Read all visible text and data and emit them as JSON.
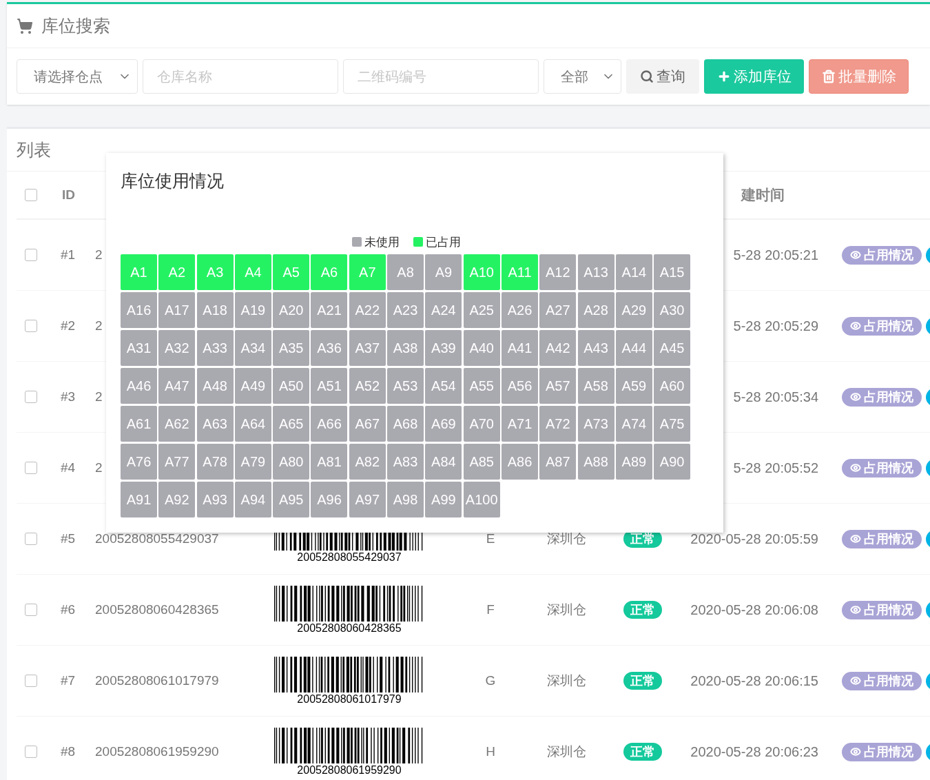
{
  "search_panel": {
    "title": "库位搜索",
    "warehouse_select": {
      "value": "请选择仓点"
    },
    "name_field": {
      "placeholder": "仓库名称"
    },
    "code_field": {
      "placeholder": "二维码编号"
    },
    "status_select": {
      "value": "全部"
    },
    "buttons": [
      {
        "kind": "search",
        "label": "查询"
      },
      {
        "kind": "add",
        "label": "添加库位"
      },
      {
        "kind": "delete",
        "label": "批量删除"
      }
    ]
  },
  "list_panel": {
    "title": "列表",
    "header": {
      "checked": false,
      "id": "ID",
      "created": "建时间"
    },
    "rows": [
      {
        "checked": false,
        "id": "#1",
        "code": "2",
        "created": "5-28 20:05:21",
        "action": "占用情况"
      },
      {
        "checked": false,
        "id": "#2",
        "code": "2",
        "created": "5-28 20:05:29",
        "action": "占用情况"
      },
      {
        "checked": false,
        "id": "#3",
        "code": "2",
        "created": "5-28 20:05:34",
        "action": "占用情况"
      },
      {
        "checked": false,
        "id": "#4",
        "code": "2",
        "created": "5-28 20:05:52",
        "action": "占用情况"
      },
      {
        "checked": false,
        "id": "#5",
        "code": "20052808055429037",
        "barcode": "20052808055429037",
        "location": "E",
        "warehouse": "深圳仓",
        "status": "正常",
        "created": "2020-05-28 20:05:59",
        "action": "占用情况"
      },
      {
        "checked": false,
        "id": "#6",
        "code": "20052808060428365",
        "barcode": "20052808060428365",
        "location": "F",
        "warehouse": "深圳仓",
        "status": "正常",
        "created": "2020-05-28 20:06:08",
        "action": "占用情况"
      },
      {
        "checked": false,
        "id": "#7",
        "code": "20052808061017979",
        "barcode": "20052808061017979",
        "location": "G",
        "warehouse": "深圳仓",
        "status": "正常",
        "created": "2020-05-28 20:06:15",
        "action": "占用情况"
      },
      {
        "checked": false,
        "id": "#8",
        "code": "20052808061959290",
        "barcode": "20052808061959290",
        "location": "H",
        "warehouse": "深圳仓",
        "status": "正常",
        "created": "2020-05-28 20:06:23",
        "action": "占用情况"
      }
    ]
  },
  "usage_popup": {
    "title": "库位使用情况",
    "legend": [
      {
        "label": "未使用",
        "color": "#a9a9b0"
      },
      {
        "label": "已占用",
        "color": "#25f263"
      }
    ],
    "slots": [
      {
        "label": "A1",
        "occupied": true
      },
      {
        "label": "A2",
        "occupied": true
      },
      {
        "label": "A3",
        "occupied": true
      },
      {
        "label": "A4",
        "occupied": true
      },
      {
        "label": "A5",
        "occupied": true
      },
      {
        "label": "A6",
        "occupied": true
      },
      {
        "label": "A7",
        "occupied": true
      },
      {
        "label": "A8",
        "occupied": false
      },
      {
        "label": "A9",
        "occupied": false
      },
      {
        "label": "A10",
        "occupied": true
      },
      {
        "label": "A11",
        "occupied": true
      },
      {
        "label": "A12",
        "occupied": false
      },
      {
        "label": "A13",
        "occupied": false
      },
      {
        "label": "A14",
        "occupied": false
      },
      {
        "label": "A15",
        "occupied": false
      },
      {
        "label": "A16",
        "occupied": false
      },
      {
        "label": "A17",
        "occupied": false
      },
      {
        "label": "A18",
        "occupied": false
      },
      {
        "label": "A19",
        "occupied": false
      },
      {
        "label": "A20",
        "occupied": false
      },
      {
        "label": "A21",
        "occupied": false
      },
      {
        "label": "A22",
        "occupied": false
      },
      {
        "label": "A23",
        "occupied": false
      },
      {
        "label": "A24",
        "occupied": false
      },
      {
        "label": "A25",
        "occupied": false
      },
      {
        "label": "A26",
        "occupied": false
      },
      {
        "label": "A27",
        "occupied": false
      },
      {
        "label": "A28",
        "occupied": false
      },
      {
        "label": "A29",
        "occupied": false
      },
      {
        "label": "A30",
        "occupied": false
      },
      {
        "label": "A31",
        "occupied": false
      },
      {
        "label": "A32",
        "occupied": false
      },
      {
        "label": "A33",
        "occupied": false
      },
      {
        "label": "A34",
        "occupied": false
      },
      {
        "label": "A35",
        "occupied": false
      },
      {
        "label": "A36",
        "occupied": false
      },
      {
        "label": "A37",
        "occupied": false
      },
      {
        "label": "A38",
        "occupied": false
      },
      {
        "label": "A39",
        "occupied": false
      },
      {
        "label": "A40",
        "occupied": false
      },
      {
        "label": "A41",
        "occupied": false
      },
      {
        "label": "A42",
        "occupied": false
      },
      {
        "label": "A43",
        "occupied": false
      },
      {
        "label": "A44",
        "occupied": false
      },
      {
        "label": "A45",
        "occupied": false
      },
      {
        "label": "A46",
        "occupied": false
      },
      {
        "label": "A47",
        "occupied": false
      },
      {
        "label": "A48",
        "occupied": false
      },
      {
        "label": "A49",
        "occupied": false
      },
      {
        "label": "A50",
        "occupied": false
      },
      {
        "label": "A51",
        "occupied": false
      },
      {
        "label": "A52",
        "occupied": false
      },
      {
        "label": "A53",
        "occupied": false
      },
      {
        "label": "A54",
        "occupied": false
      },
      {
        "label": "A55",
        "occupied": false
      },
      {
        "label": "A56",
        "occupied": false
      },
      {
        "label": "A57",
        "occupied": false
      },
      {
        "label": "A58",
        "occupied": false
      },
      {
        "label": "A59",
        "occupied": false
      },
      {
        "label": "A60",
        "occupied": false
      },
      {
        "label": "A61",
        "occupied": false
      },
      {
        "label": "A62",
        "occupied": false
      },
      {
        "label": "A63",
        "occupied": false
      },
      {
        "label": "A64",
        "occupied": false
      },
      {
        "label": "A65",
        "occupied": false
      },
      {
        "label": "A66",
        "occupied": false
      },
      {
        "label": "A67",
        "occupied": false
      },
      {
        "label": "A68",
        "occupied": false
      },
      {
        "label": "A69",
        "occupied": false
      },
      {
        "label": "A70",
        "occupied": false
      },
      {
        "label": "A71",
        "occupied": false
      },
      {
        "label": "A72",
        "occupied": false
      },
      {
        "label": "A73",
        "occupied": false
      },
      {
        "label": "A74",
        "occupied": false
      },
      {
        "label": "A75",
        "occupied": false
      },
      {
        "label": "A76",
        "occupied": false
      },
      {
        "label": "A77",
        "occupied": false
      },
      {
        "label": "A78",
        "occupied": false
      },
      {
        "label": "A79",
        "occupied": false
      },
      {
        "label": "A80",
        "occupied": false
      },
      {
        "label": "A81",
        "occupied": false
      },
      {
        "label": "A82",
        "occupied": false
      },
      {
        "label": "A83",
        "occupied": false
      },
      {
        "label": "A84",
        "occupied": false
      },
      {
        "label": "A85",
        "occupied": false
      },
      {
        "label": "A86",
        "occupied": false
      },
      {
        "label": "A87",
        "occupied": false
      },
      {
        "label": "A88",
        "occupied": false
      },
      {
        "label": "A89",
        "occupied": false
      },
      {
        "label": "A90",
        "occupied": false
      },
      {
        "label": "A91",
        "occupied": false
      },
      {
        "label": "A92",
        "occupied": false
      },
      {
        "label": "A93",
        "occupied": false
      },
      {
        "label": "A94",
        "occupied": false
      },
      {
        "label": "A95",
        "occupied": false
      },
      {
        "label": "A96",
        "occupied": false
      },
      {
        "label": "A97",
        "occupied": false
      },
      {
        "label": "A98",
        "occupied": false
      },
      {
        "label": "A99",
        "occupied": false
      },
      {
        "label": "A100",
        "occupied": false
      }
    ]
  }
}
